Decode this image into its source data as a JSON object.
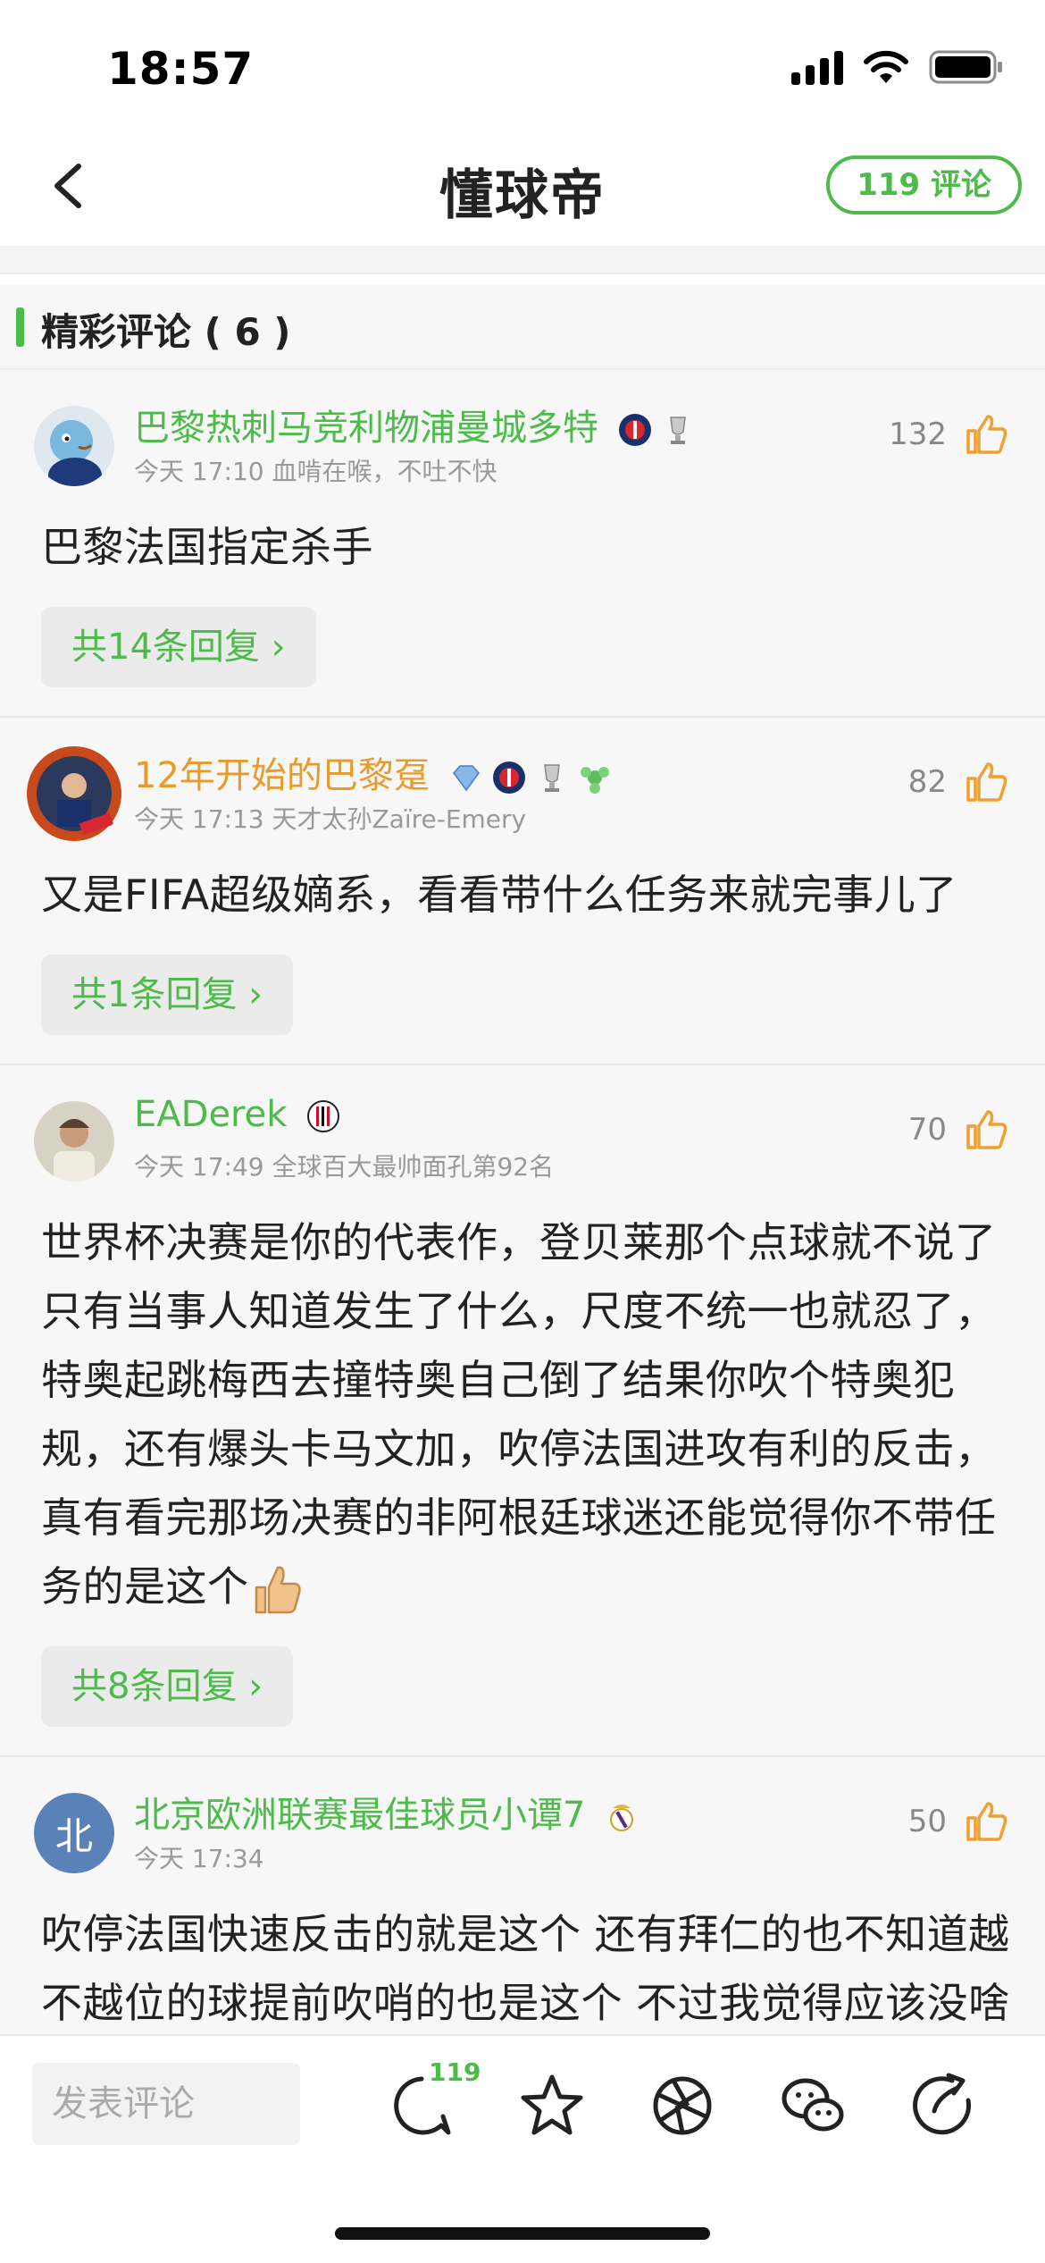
{
  "status_bar": {
    "time": "18:57"
  },
  "nav": {
    "title": "懂球帝",
    "comment_count": "119 评论"
  },
  "section": {
    "title": "精彩评论 ( 6 )"
  },
  "comments": [
    {
      "username": "巴黎热刺马竞利物浦曼城多特",
      "meta": "今天 17:10 血啃在喉，不吐不快",
      "likes": "132",
      "body": "巴黎法国指定杀手",
      "replies": "共14条回复 ›"
    },
    {
      "username": "12年开始的巴黎趸",
      "meta": "今天 17:13 天才太孙Zaïre-Emery",
      "likes": "82",
      "body": "又是FIFA超级嫡系，看看带什么任务来就完事儿了",
      "replies": "共1条回复 ›"
    },
    {
      "username": "EADerek",
      "meta": "今天 17:49 全球百大最帅面孔第92名",
      "likes": "70",
      "body": "世界杯决赛是你的代表作，登贝莱那个点球就不说了只有当事人知道发生了什么，尺度不统一也就忍了，特奥起跳梅西去撞特奥自己倒了结果你吹个特奥犯规，还有爆头卡马文加，吹停法国进攻有利的反击，真有看完那场决赛的非阿根廷球迷还能觉得你不带任务的是这个",
      "replies": "共8条回复 ›"
    },
    {
      "username": "北京欧洲联赛最佳球员小谭7",
      "avatar_text": "北",
      "meta": "今天 17:34",
      "likes": "50",
      "body": "吹停法国快速反击的就是这个 还有拜仁的也不知道越不越位的球提前吹哨的也是这个 不过我觉得应该没啥争议 皇马打高位会被巴黎冲烂掉"
    }
  ],
  "toolbar": {
    "input_placeholder": "发表评论",
    "comment_badge": "119"
  },
  "colors": {
    "accent": "#4cbb4a",
    "gold": "#e89a2a",
    "like": "#f0a030"
  }
}
